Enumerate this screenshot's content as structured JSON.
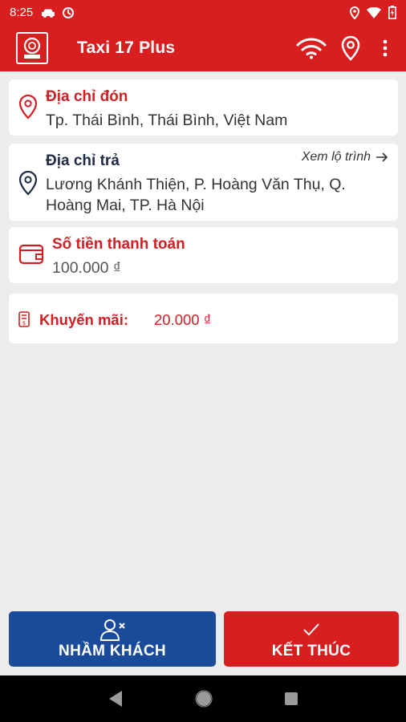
{
  "status_bar": {
    "time": "8:25",
    "icons_left": [
      "car-icon",
      "data-saver-icon"
    ],
    "icons_right": [
      "location-icon",
      "wifi-icon",
      "battery-icon"
    ]
  },
  "app_bar": {
    "title": "Taxi 17 Plus",
    "logo_text": "TAXI",
    "actions": [
      "wifi-icon",
      "location-pin-icon",
      "more-vert-icon"
    ]
  },
  "pickup": {
    "label": "Địa chỉ đón",
    "address": "Tp. Thái Bình, Thái Bình, Việt Nam"
  },
  "dropoff": {
    "label": "Địa chỉ trả",
    "address_line1": "Lương Khánh Thiện, P. Hoàng Văn Thụ, Q.",
    "address_line2": "Hoàng Mai, TP. Hà Nội",
    "route_link": "Xem lộ trình"
  },
  "payment": {
    "label": "Số tiền thanh toán",
    "amount": "100.000 ₫"
  },
  "promotion": {
    "label": "Khuyến mãi:",
    "amount": "20.000 ₫"
  },
  "buttons": {
    "wrong_customer": "NHẦM KHÁCH",
    "finish": "KẾT THÚC"
  },
  "colors": {
    "primary_red": "#d81e1e",
    "accent_blue": "#1a4b9b",
    "text_red": "#d21f24",
    "background": "#ececec"
  }
}
